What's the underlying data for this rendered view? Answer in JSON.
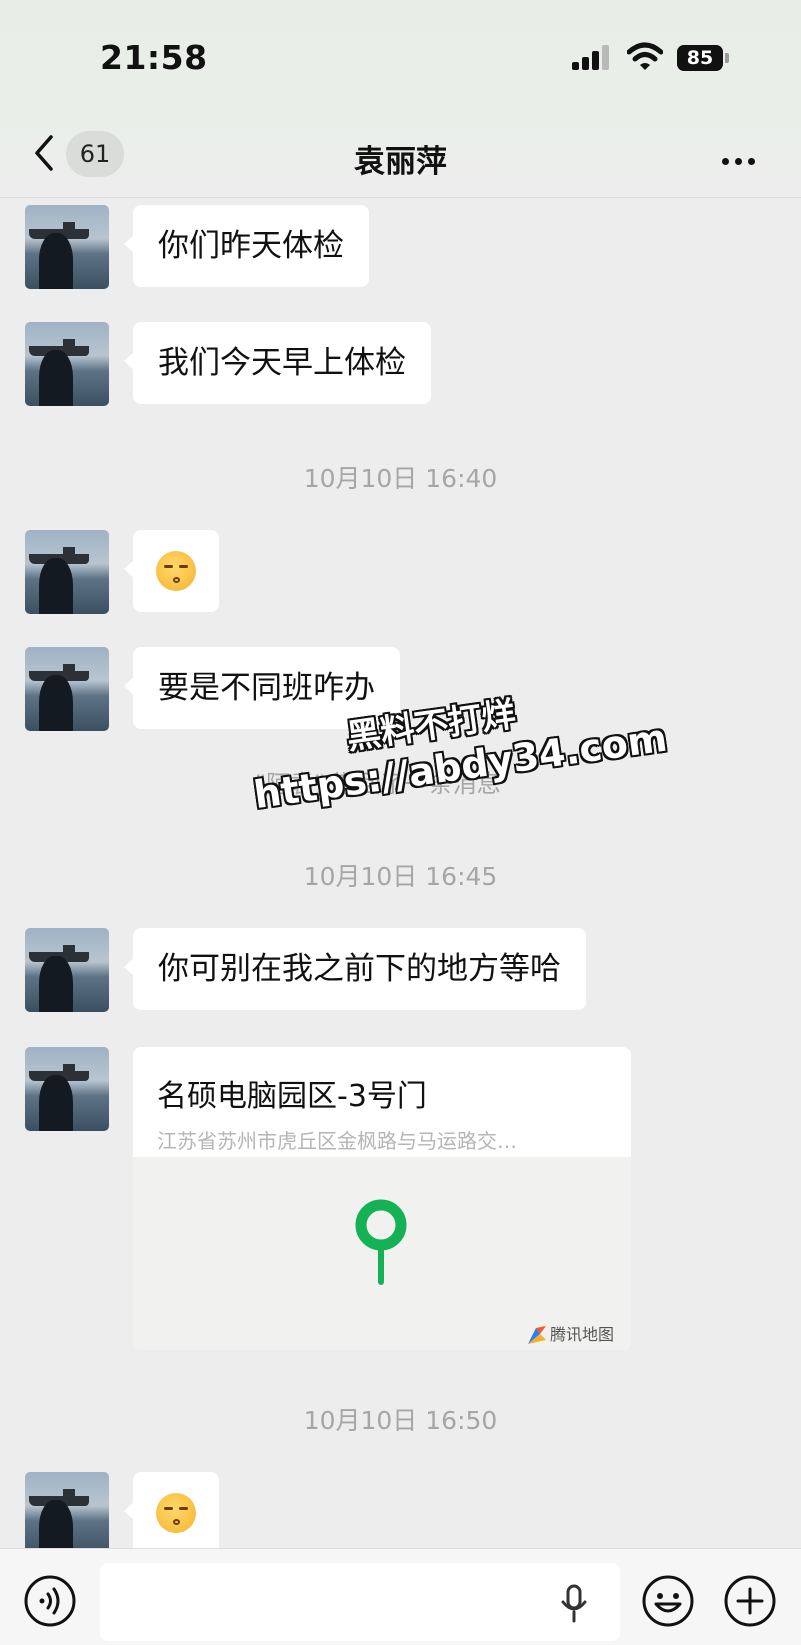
{
  "status_bar": {
    "time": "21:58",
    "battery": "85",
    "icons": [
      "signal-icon",
      "wifi-icon",
      "battery-icon"
    ]
  },
  "header": {
    "back_icon": "chevron-left-icon",
    "unread_count": "61",
    "title": "袁丽萍",
    "more_icon": "more-dots-icon"
  },
  "messages": [
    {
      "type": "text",
      "text": "你们昨天体检"
    },
    {
      "type": "text",
      "text": "我们今天早上体检"
    },
    {
      "type": "timestamp",
      "text": "10月10日 16:40"
    },
    {
      "type": "emoji",
      "emoji": "kissing-face-closed-eyes"
    },
    {
      "type": "text",
      "text": "要是不同班咋办"
    },
    {
      "type": "system",
      "text": "\"阿袁\" 撤回了一条消息"
    },
    {
      "type": "timestamp",
      "text": "10月10日 16:45"
    },
    {
      "type": "text",
      "text": "你可别在我之前下的地方等哈"
    },
    {
      "type": "location",
      "name": "名硕电脑园区-3号门",
      "address": "江苏省苏州市虎丘区金枫路与马运路交…",
      "provider": "腾讯地图"
    },
    {
      "type": "timestamp",
      "text": "10月10日 16:50"
    },
    {
      "type": "emoji",
      "emoji": "kissing-face-closed-eyes"
    }
  ],
  "watermark": {
    "line1": "黑料不打烊",
    "line2": "https://abdy34.com"
  },
  "input_bar": {
    "value": "",
    "icons": [
      "voice-icon",
      "microphone-icon",
      "emoji-icon",
      "plus-icon"
    ]
  },
  "colors": {
    "background": "#ededed",
    "bubble": "#ffffff",
    "timestamp": "#a6a6a6",
    "map_pin": "#14b155"
  }
}
